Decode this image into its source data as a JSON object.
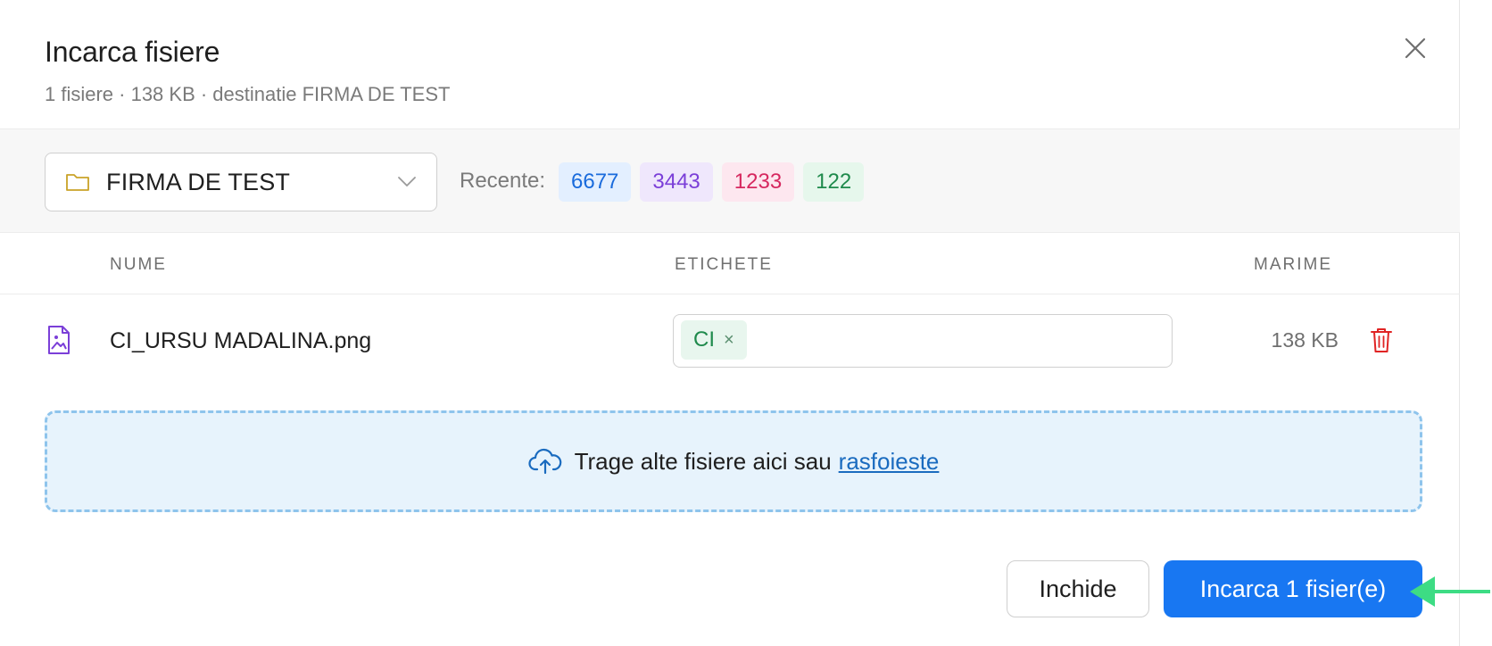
{
  "dialog": {
    "title": "Incarca fisiere",
    "subtitle": "1 fisiere · 138 KB · destinatie FIRMA DE TEST"
  },
  "toolbar": {
    "destination": "FIRMA DE TEST",
    "recent_label": "Recente:",
    "recent": [
      {
        "label": "6677",
        "bg": "#e3efff",
        "fg": "#1a6bdc"
      },
      {
        "label": "3443",
        "bg": "#efe7fc",
        "fg": "#7b3fd8"
      },
      {
        "label": "1233",
        "bg": "#fde7ef",
        "fg": "#d6285f"
      },
      {
        "label": "122",
        "bg": "#e6f7ec",
        "fg": "#1f8a4c"
      }
    ]
  },
  "table": {
    "headers": {
      "name": "NUME",
      "tags": "ETICHETE",
      "size": "MARIME"
    },
    "rows": [
      {
        "name": "CI_URSU MADALINA.png",
        "tags": [
          "CI"
        ],
        "size": "138 KB"
      }
    ]
  },
  "dropzone": {
    "text": "Trage alte fisiere aici sau",
    "link": "rasfoieste"
  },
  "footer": {
    "close_label": "Inchide",
    "upload_label": "Incarca 1 fisier(e)"
  },
  "colors": {
    "primary": "#1877f2",
    "file_icon": "#7b3fd8",
    "trash_icon": "#e02424",
    "folder_icon": "#c9a227",
    "annotation_arrow": "#3ddc84"
  },
  "icons": {
    "close": "close-icon",
    "folder": "folder-icon",
    "chevron": "chevron-down-icon",
    "file": "image-file-icon",
    "tag_remove": "remove-tag-icon",
    "trash": "trash-icon",
    "upload": "cloud-upload-icon",
    "arrow": "pointer-arrow-icon"
  }
}
